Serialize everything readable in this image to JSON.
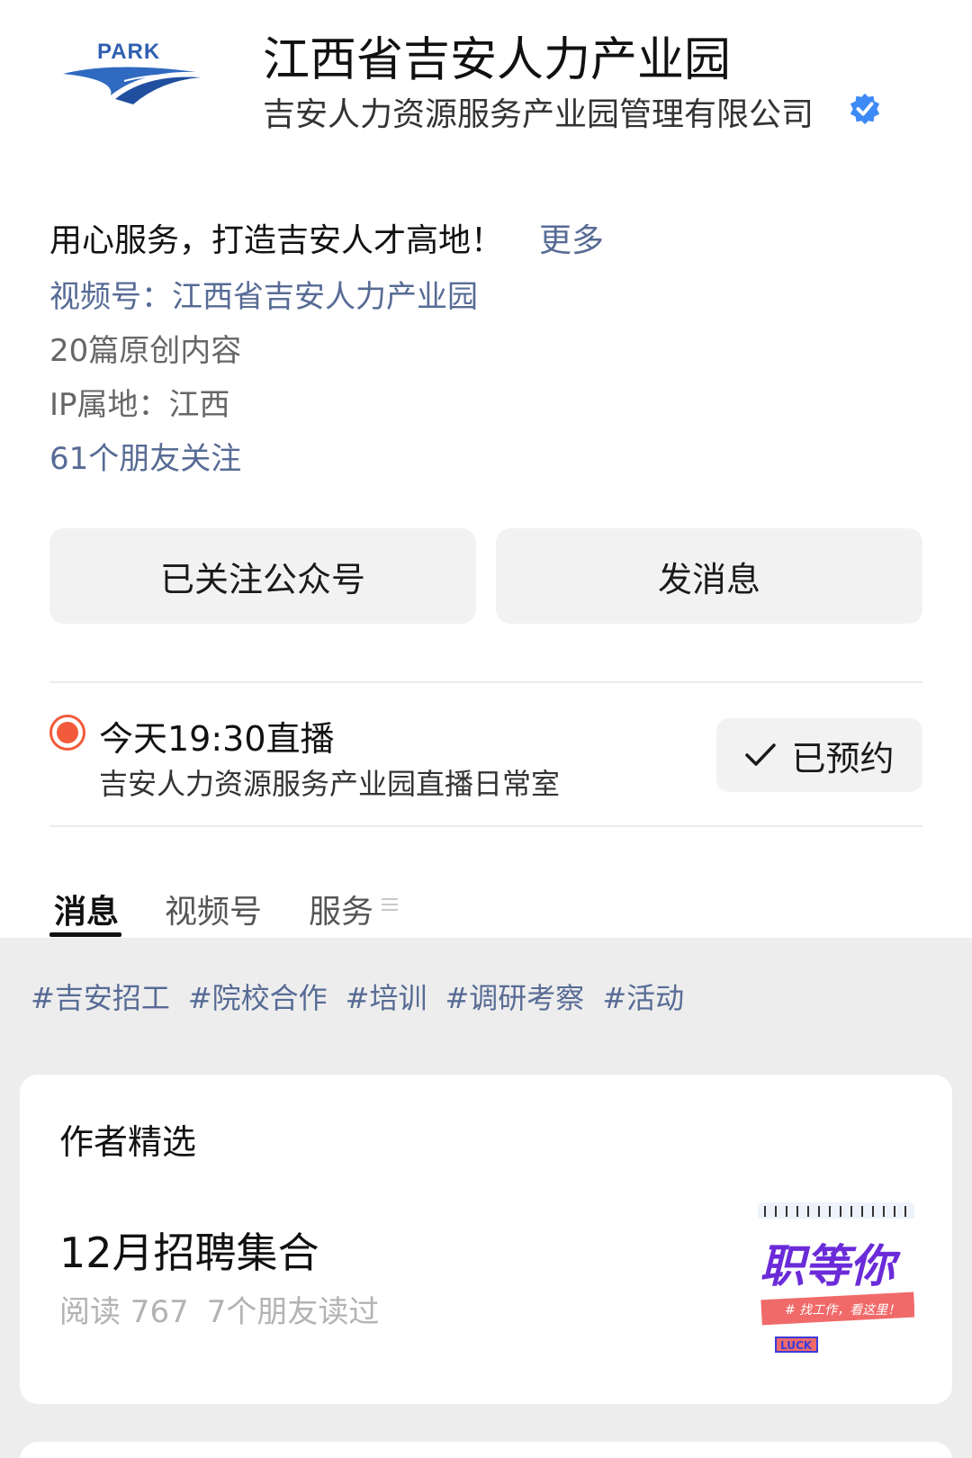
{
  "header": {
    "logo_text": "PARK",
    "account_name": "江西省吉安人力产业园",
    "company": "吉安人力资源服务产业园管理有限公司",
    "verified_icon": "verified-badge-icon",
    "brand_color": "#2f5fb0"
  },
  "bio": {
    "text": "用心服务，打造吉安人才高地！",
    "more": "更多"
  },
  "info": {
    "video_channel": "视频号：江西省吉安人力产业园",
    "original_count": "20篇原创内容",
    "ip_location": "IP属地：江西",
    "friends_follow": "61个朋友关注"
  },
  "actions": {
    "followed_label": "已关注公众号",
    "message_label": "发消息"
  },
  "live": {
    "title": "今天19:30直播",
    "room": "吉安人力资源服务产业园直播日常室",
    "reserved_label": "已预约"
  },
  "tabs": [
    {
      "label": "消息",
      "active": true
    },
    {
      "label": "视频号",
      "active": false
    },
    {
      "label": "服务",
      "active": false
    }
  ],
  "hashtags": [
    "#吉安招工",
    "#院校合作",
    "#培训",
    "#调研考察",
    "#活动"
  ],
  "featured": {
    "section_title": "作者精选",
    "article_title": "12月招聘集合",
    "reads": "阅读 767",
    "friends_read": "7个朋友读过",
    "thumb_text": "职等你",
    "thumb_sub": "# 找工作，看这里！",
    "thumb_badge": "LUCK"
  },
  "colors": {
    "link": "#576b95",
    "live_red": "#f15a3a",
    "button_bg": "#f2f2f2",
    "verified_blue": "#3d8af7"
  }
}
